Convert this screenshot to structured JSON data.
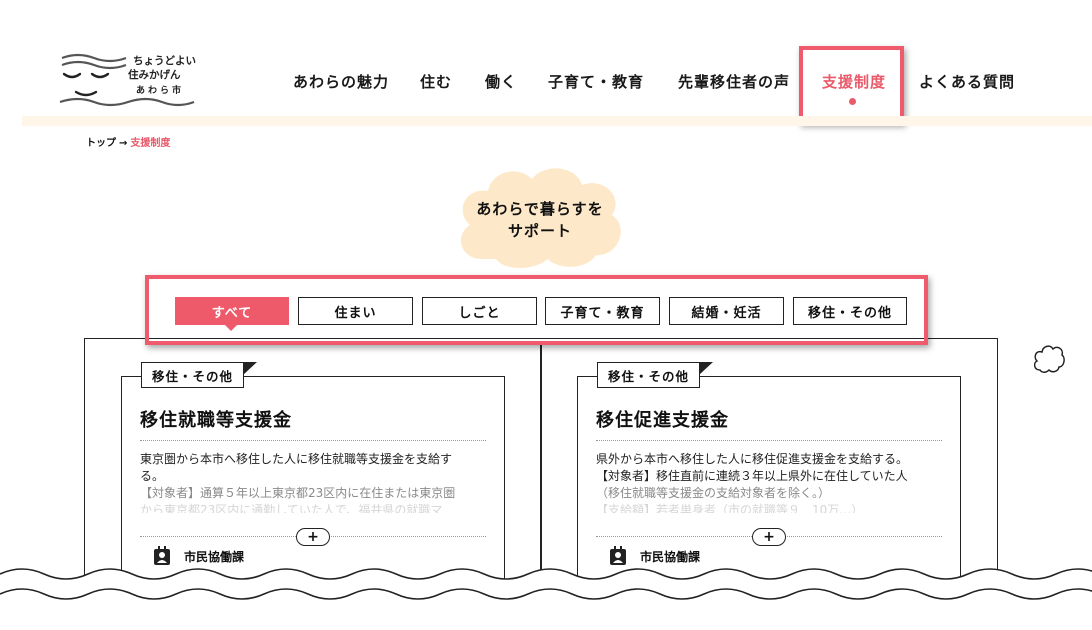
{
  "logo": {
    "line1": "ちょうどよい",
    "line2": "住みかげん",
    "line3": "あわら市"
  },
  "nav": {
    "items": [
      {
        "label": "あわらの魅力"
      },
      {
        "label": "住む"
      },
      {
        "label": "働く"
      },
      {
        "label": "子育て・教育"
      },
      {
        "label": "先輩移住者の声"
      },
      {
        "label": "支援制度"
      },
      {
        "label": "よくある質問"
      }
    ],
    "active_index": 5
  },
  "breadcrumb": {
    "home": "トップ",
    "separator": "→",
    "current": "支援制度"
  },
  "section": {
    "title_line1": "あわらで暮らすを",
    "title_line2": "サポート"
  },
  "filters": {
    "tabs": [
      {
        "label": "すべて"
      },
      {
        "label": "住まい"
      },
      {
        "label": "しごと"
      },
      {
        "label": "子育て・教育"
      },
      {
        "label": "結婚・妊活"
      },
      {
        "label": "移住・その他"
      }
    ],
    "active_index": 0
  },
  "cards": [
    {
      "tag": "移住・その他",
      "title": "移住就職等支援金",
      "desc_line1": "東京圏から本市へ移住した人に移住就職等支援金を支給す",
      "desc_line2": "る。",
      "desc_line3": "【対象者】通算５年以上東京都23区内に在住または東京圏",
      "desc_line4": "から東京都23区内に通勤していた人で、福井県の就職マ",
      "expand": "+",
      "department": "市民協働課"
    },
    {
      "tag": "移住・その他",
      "title": "移住促進支援金",
      "desc_line1": "県外から本市へ移住した人に移住促進支援金を支給する。",
      "desc_line2": "【対象者】移住直前に連続３年以上県外に在住していた人",
      "desc_line3": "（移住就職等支援金の支給対象者を除く。）",
      "desc_line4": "【支給額】若者単身者（市の就職等９　10万…）",
      "expand": "+",
      "department": "市民協働課"
    }
  ],
  "colors": {
    "accent": "#e95a6a",
    "highlight": "#ef5a6c",
    "cloud": "#fde9c9",
    "band": "#fff5e9"
  }
}
